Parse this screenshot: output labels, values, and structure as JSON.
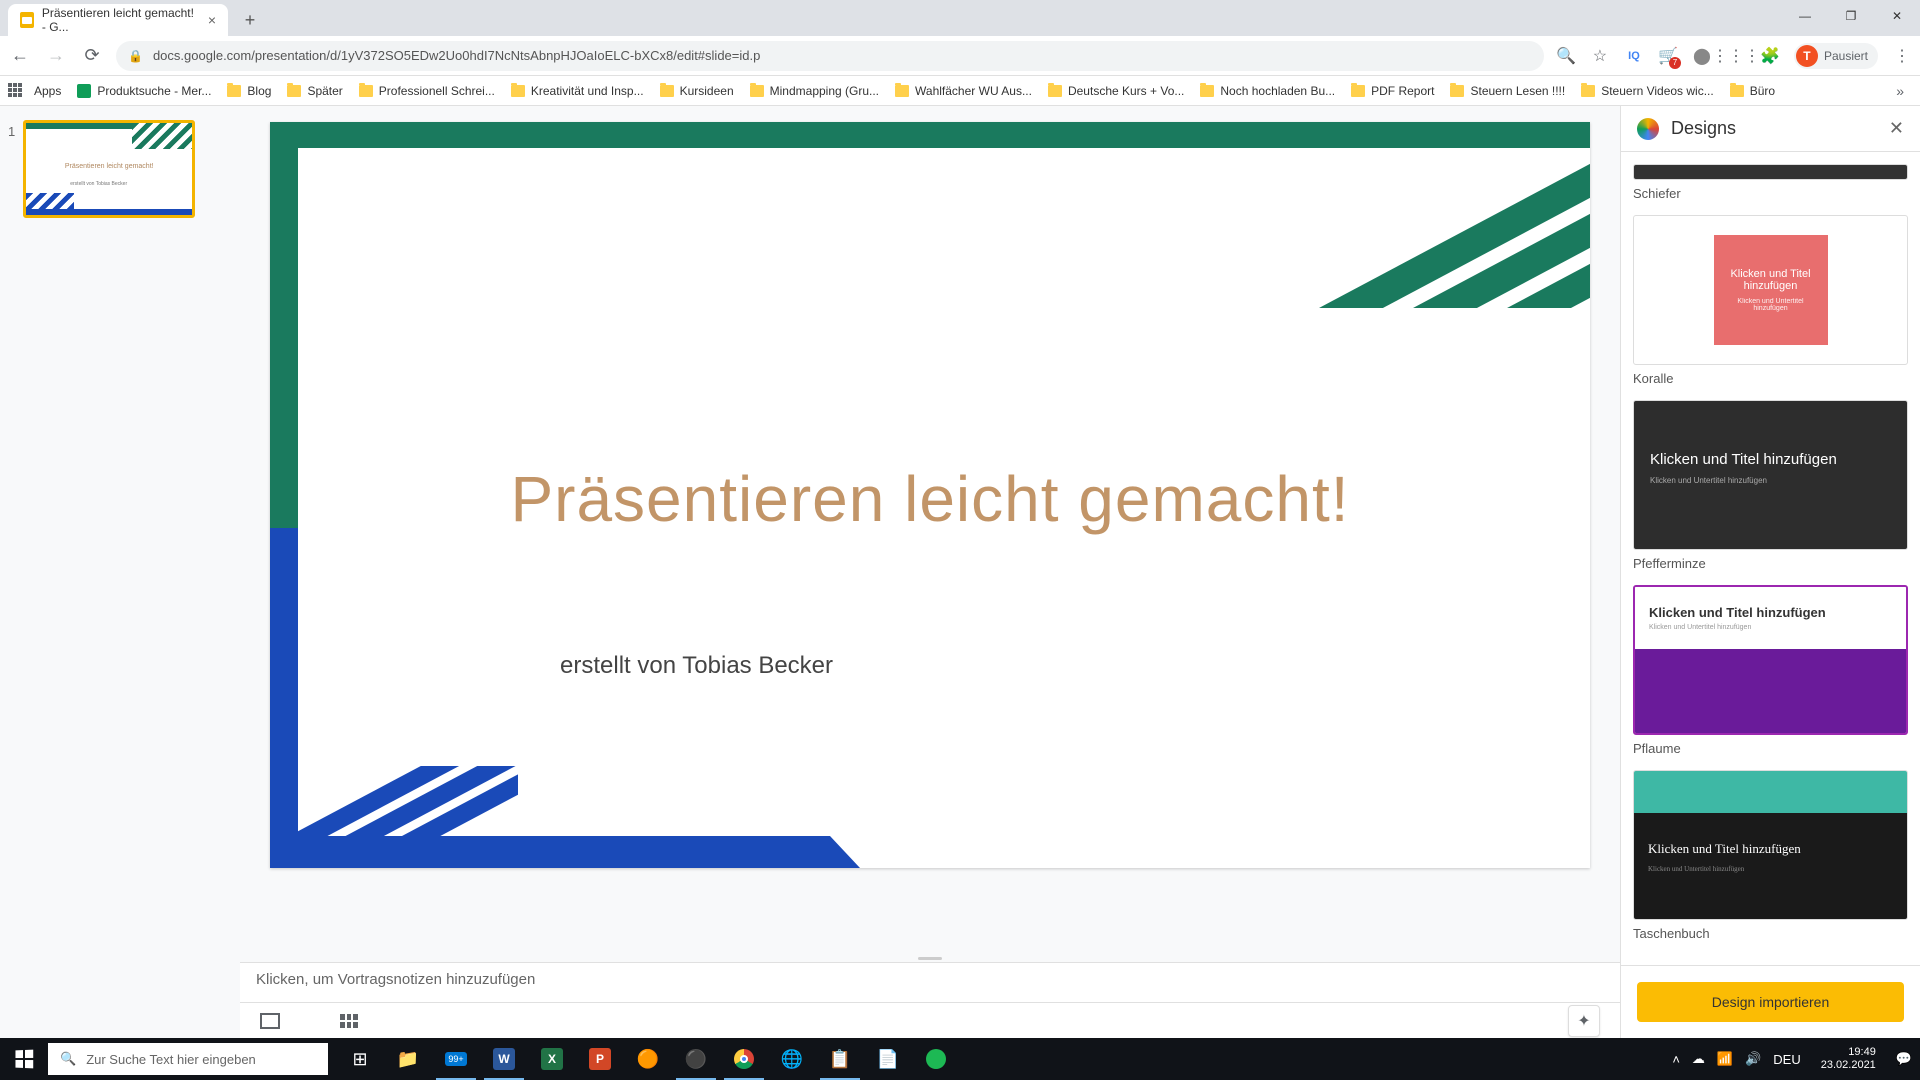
{
  "browser": {
    "tab_title": "Präsentieren leicht gemacht! - G...",
    "url": "docs.google.com/presentation/d/1yV372SO5EDw2Uo0hdI7NcNtsAbnpHJOaIoELC-bXCx8/edit#slide=id.p",
    "profile_label": "Pausiert",
    "profile_initial": "T",
    "apps_label": "Apps"
  },
  "bookmarks": [
    "Produktsuche - Mer...",
    "Blog",
    "Später",
    "Professionell Schrei...",
    "Kreativität und Insp...",
    "Kursideen",
    "Mindmapping (Gru...",
    "Wahlfächer WU Aus...",
    "Deutsche Kurs + Vo...",
    "Noch hochladen Bu...",
    "PDF Report",
    "Steuern Lesen !!!!",
    "Steuern Videos wic...",
    "Büro"
  ],
  "slide_panel": {
    "slide_number": "1",
    "thumb_title": "Präsentieren leicht gemacht!",
    "thumb_sub": "erstellt von Tobias Becker"
  },
  "slide": {
    "title": "Präsentieren leicht gemacht!",
    "subtitle": "erstellt von Tobias Becker"
  },
  "notes_placeholder": "Klicken, um Vortragsnotizen hinzuzufügen",
  "designs": {
    "panel_title": "Designs",
    "items": [
      {
        "name": "Schiefer"
      },
      {
        "name": "Koralle",
        "title": "Klicken und Titel hinzufügen",
        "sub": "Klicken und Untertitel hinzufügen"
      },
      {
        "name": "Pfefferminze",
        "title": "Klicken und Titel hinzufügen",
        "sub": "Klicken und Untertitel hinzufügen"
      },
      {
        "name": "Pflaume",
        "title": "Klicken und Titel hinzufügen",
        "sub": "Klicken und Untertitel hinzufügen"
      },
      {
        "name": "Taschenbuch",
        "title": "Klicken und Titel hinzufügen",
        "sub": "Klicken und Untertitel hinzufügen"
      }
    ],
    "import_button": "Design importieren"
  },
  "taskbar": {
    "search_placeholder": "Zur Suche Text hier eingeben",
    "lang": "DEU",
    "time": "19:49",
    "date": "23.02.2021",
    "badge": "99+"
  },
  "colors": {
    "accent_green": "#1a7a5e",
    "accent_blue": "#1a4ab8",
    "title_color": "#c29568",
    "yellow": "#fbbc04"
  }
}
